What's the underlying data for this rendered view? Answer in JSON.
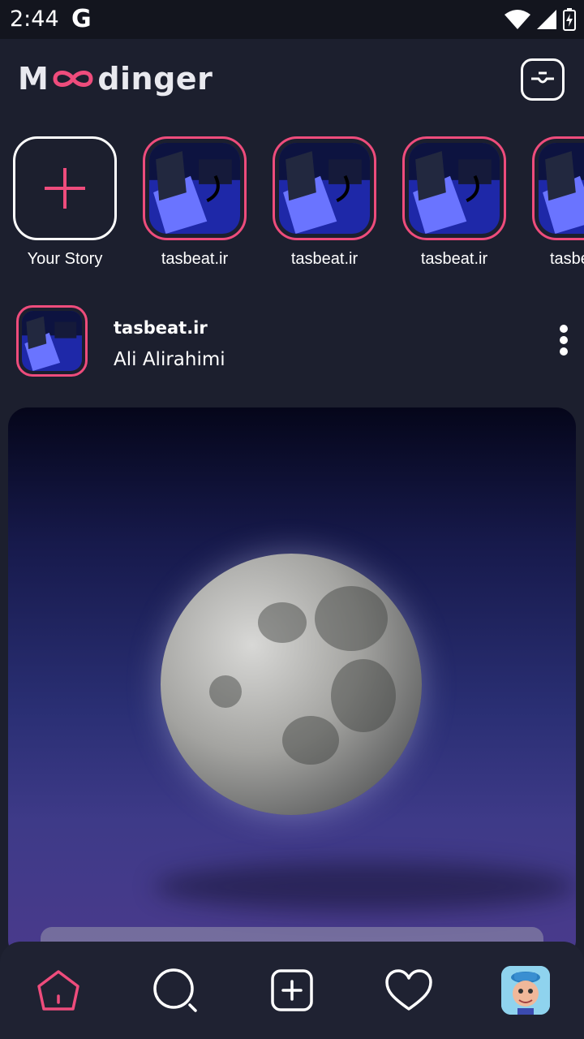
{
  "status_bar": {
    "time": "2:44",
    "google": "G"
  },
  "header": {
    "logo_prefix": "M",
    "logo_suffix": "dinger"
  },
  "stories": [
    {
      "label": "Your Story",
      "own": true
    },
    {
      "label": "tasbeat.ir"
    },
    {
      "label": "tasbeat.ir"
    },
    {
      "label": "tasbeat.ir"
    },
    {
      "label": "tasbe"
    }
  ],
  "post": {
    "username": "tasbeat.ir",
    "full_name": "Ali Alirahimi"
  },
  "colors": {
    "accent": "#ee4c7c",
    "background": "#1c1f2e",
    "nav": "#1f2232"
  },
  "nav": {
    "items": [
      {
        "name": "home-icon",
        "active": true
      },
      {
        "name": "search-icon"
      },
      {
        "name": "add-post-icon"
      },
      {
        "name": "heart-icon"
      },
      {
        "name": "profile-avatar"
      }
    ]
  }
}
